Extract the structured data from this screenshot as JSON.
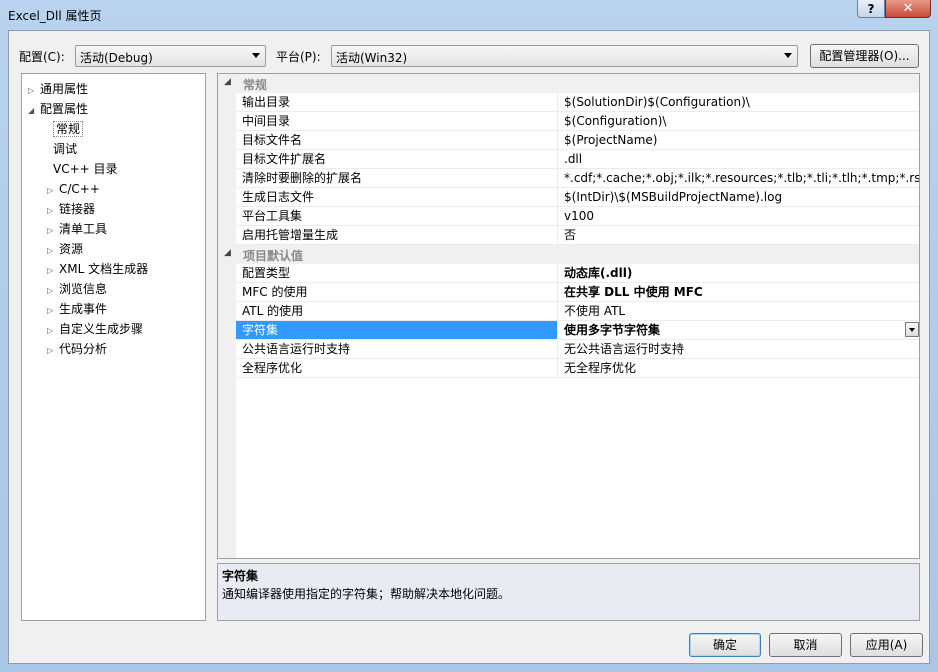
{
  "window": {
    "title": "Excel_Dll 属性页"
  },
  "titlebar_buttons": {
    "help": "?",
    "close": "✕"
  },
  "toolbar": {
    "config_label": "配置(C):",
    "config_value": "活动(Debug)",
    "platform_label": "平台(P):",
    "platform_value": "活动(Win32)",
    "config_manager_label": "配置管理器(O)..."
  },
  "tree": {
    "items": [
      {
        "label": "通用属性",
        "expander": "▷",
        "level": 0
      },
      {
        "label": "配置属性",
        "expander": "◢",
        "level": 0
      },
      {
        "label": "常规",
        "expander": "",
        "level": 1
      },
      {
        "label": "调试",
        "expander": "",
        "level": 1
      },
      {
        "label": "VC++ 目录",
        "expander": "",
        "level": 1
      },
      {
        "label": "C/C++",
        "expander": "▷",
        "level": 1
      },
      {
        "label": "链接器",
        "expander": "▷",
        "level": 1
      },
      {
        "label": "清单工具",
        "expander": "▷",
        "level": 1
      },
      {
        "label": "资源",
        "expander": "▷",
        "level": 1
      },
      {
        "label": "XML 文档生成器",
        "expander": "▷",
        "level": 1
      },
      {
        "label": "浏览信息",
        "expander": "▷",
        "level": 1
      },
      {
        "label": "生成事件",
        "expander": "▷",
        "level": 1
      },
      {
        "label": "自定义生成步骤",
        "expander": "▷",
        "level": 1
      },
      {
        "label": "代码分析",
        "expander": "▷",
        "level": 1
      }
    ]
  },
  "grid": {
    "categories": [
      {
        "name": "常规",
        "toggle": "◢",
        "rows": [
          {
            "name": "输出目录",
            "value": "$(SolutionDir)$(Configuration)\\"
          },
          {
            "name": "中间目录",
            "value": "$(Configuration)\\"
          },
          {
            "name": "目标文件名",
            "value": "$(ProjectName)"
          },
          {
            "name": "目标文件扩展名",
            "value": ".dll"
          },
          {
            "name": "清除时要删除的扩展名",
            "value": "*.cdf;*.cache;*.obj;*.ilk;*.resources;*.tlb;*.tli;*.tlh;*.tmp;*.rsp;*.pgc"
          },
          {
            "name": "生成日志文件",
            "value": "$(IntDir)\\$(MSBuildProjectName).log"
          },
          {
            "name": "平台工具集",
            "value": "v100"
          },
          {
            "name": "启用托管增量生成",
            "value": "否"
          }
        ]
      },
      {
        "name": "项目默认值",
        "toggle": "◢",
        "rows": [
          {
            "name": "配置类型",
            "value": "动态库(.dll)"
          },
          {
            "name": "MFC 的使用",
            "value": "在共享 DLL 中使用 MFC"
          },
          {
            "name": "ATL 的使用",
            "value": "不使用 ATL"
          },
          {
            "name": "字符集",
            "value": "使用多字节字符集"
          },
          {
            "name": "公共语言运行时支持",
            "value": "无公共语言运行时支持"
          },
          {
            "name": "全程序优化",
            "value": "无全程序优化"
          }
        ]
      }
    ]
  },
  "description": {
    "title": "字符集",
    "text": "通知编译器使用指定的字符集；帮助解决本地化问题。"
  },
  "buttons": {
    "ok": "确定",
    "cancel": "取消",
    "apply": "应用(A)"
  }
}
